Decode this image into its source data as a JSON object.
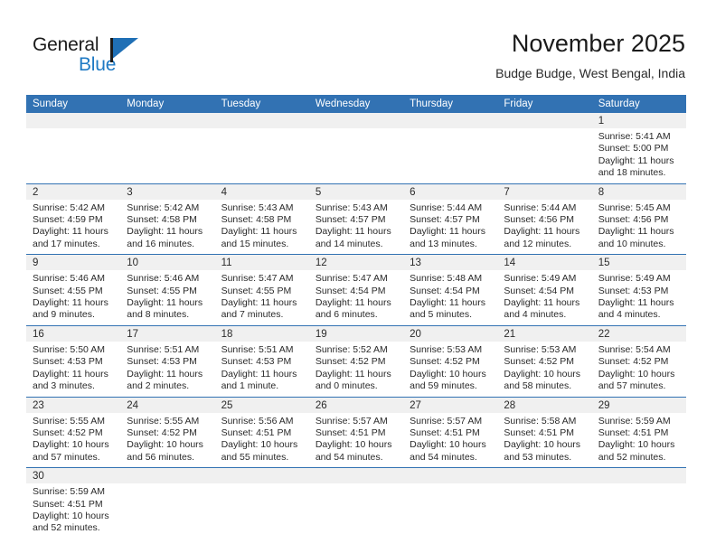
{
  "brand": {
    "line1": "General",
    "line2": "Blue",
    "flag_color": "#1f7ac4"
  },
  "header": {
    "title": "November 2025",
    "subtitle": "Budge Budge, West Bengal, India"
  },
  "theme": {
    "header_blue": "#3272b3",
    "date_band_gray": "#f0f0f0",
    "text": "#2a2a2a"
  },
  "weekdays": [
    "Sunday",
    "Monday",
    "Tuesday",
    "Wednesday",
    "Thursday",
    "Friday",
    "Saturday"
  ],
  "labels": {
    "sunrise": "Sunrise:",
    "sunset": "Sunset:",
    "daylight": "Daylight:"
  },
  "weeks": [
    [
      {
        "empty": true
      },
      {
        "empty": true
      },
      {
        "empty": true
      },
      {
        "empty": true
      },
      {
        "empty": true
      },
      {
        "empty": true
      },
      {
        "day": "1",
        "sunrise": "Sunrise: 5:41 AM",
        "sunset": "Sunset: 5:00 PM",
        "daylight": "Daylight: 11 hours and 18 minutes."
      }
    ],
    [
      {
        "day": "2",
        "sunrise": "Sunrise: 5:42 AM",
        "sunset": "Sunset: 4:59 PM",
        "daylight": "Daylight: 11 hours and 17 minutes."
      },
      {
        "day": "3",
        "sunrise": "Sunrise: 5:42 AM",
        "sunset": "Sunset: 4:58 PM",
        "daylight": "Daylight: 11 hours and 16 minutes."
      },
      {
        "day": "4",
        "sunrise": "Sunrise: 5:43 AM",
        "sunset": "Sunset: 4:58 PM",
        "daylight": "Daylight: 11 hours and 15 minutes."
      },
      {
        "day": "5",
        "sunrise": "Sunrise: 5:43 AM",
        "sunset": "Sunset: 4:57 PM",
        "daylight": "Daylight: 11 hours and 14 minutes."
      },
      {
        "day": "6",
        "sunrise": "Sunrise: 5:44 AM",
        "sunset": "Sunset: 4:57 PM",
        "daylight": "Daylight: 11 hours and 13 minutes."
      },
      {
        "day": "7",
        "sunrise": "Sunrise: 5:44 AM",
        "sunset": "Sunset: 4:56 PM",
        "daylight": "Daylight: 11 hours and 12 minutes."
      },
      {
        "day": "8",
        "sunrise": "Sunrise: 5:45 AM",
        "sunset": "Sunset: 4:56 PM",
        "daylight": "Daylight: 11 hours and 10 minutes."
      }
    ],
    [
      {
        "day": "9",
        "sunrise": "Sunrise: 5:46 AM",
        "sunset": "Sunset: 4:55 PM",
        "daylight": "Daylight: 11 hours and 9 minutes."
      },
      {
        "day": "10",
        "sunrise": "Sunrise: 5:46 AM",
        "sunset": "Sunset: 4:55 PM",
        "daylight": "Daylight: 11 hours and 8 minutes."
      },
      {
        "day": "11",
        "sunrise": "Sunrise: 5:47 AM",
        "sunset": "Sunset: 4:55 PM",
        "daylight": "Daylight: 11 hours and 7 minutes."
      },
      {
        "day": "12",
        "sunrise": "Sunrise: 5:47 AM",
        "sunset": "Sunset: 4:54 PM",
        "daylight": "Daylight: 11 hours and 6 minutes."
      },
      {
        "day": "13",
        "sunrise": "Sunrise: 5:48 AM",
        "sunset": "Sunset: 4:54 PM",
        "daylight": "Daylight: 11 hours and 5 minutes."
      },
      {
        "day": "14",
        "sunrise": "Sunrise: 5:49 AM",
        "sunset": "Sunset: 4:54 PM",
        "daylight": "Daylight: 11 hours and 4 minutes."
      },
      {
        "day": "15",
        "sunrise": "Sunrise: 5:49 AM",
        "sunset": "Sunset: 4:53 PM",
        "daylight": "Daylight: 11 hours and 4 minutes."
      }
    ],
    [
      {
        "day": "16",
        "sunrise": "Sunrise: 5:50 AM",
        "sunset": "Sunset: 4:53 PM",
        "daylight": "Daylight: 11 hours and 3 minutes."
      },
      {
        "day": "17",
        "sunrise": "Sunrise: 5:51 AM",
        "sunset": "Sunset: 4:53 PM",
        "daylight": "Daylight: 11 hours and 2 minutes."
      },
      {
        "day": "18",
        "sunrise": "Sunrise: 5:51 AM",
        "sunset": "Sunset: 4:53 PM",
        "daylight": "Daylight: 11 hours and 1 minute."
      },
      {
        "day": "19",
        "sunrise": "Sunrise: 5:52 AM",
        "sunset": "Sunset: 4:52 PM",
        "daylight": "Daylight: 11 hours and 0 minutes."
      },
      {
        "day": "20",
        "sunrise": "Sunrise: 5:53 AM",
        "sunset": "Sunset: 4:52 PM",
        "daylight": "Daylight: 10 hours and 59 minutes."
      },
      {
        "day": "21",
        "sunrise": "Sunrise: 5:53 AM",
        "sunset": "Sunset: 4:52 PM",
        "daylight": "Daylight: 10 hours and 58 minutes."
      },
      {
        "day": "22",
        "sunrise": "Sunrise: 5:54 AM",
        "sunset": "Sunset: 4:52 PM",
        "daylight": "Daylight: 10 hours and 57 minutes."
      }
    ],
    [
      {
        "day": "23",
        "sunrise": "Sunrise: 5:55 AM",
        "sunset": "Sunset: 4:52 PM",
        "daylight": "Daylight: 10 hours and 57 minutes."
      },
      {
        "day": "24",
        "sunrise": "Sunrise: 5:55 AM",
        "sunset": "Sunset: 4:52 PM",
        "daylight": "Daylight: 10 hours and 56 minutes."
      },
      {
        "day": "25",
        "sunrise": "Sunrise: 5:56 AM",
        "sunset": "Sunset: 4:51 PM",
        "daylight": "Daylight: 10 hours and 55 minutes."
      },
      {
        "day": "26",
        "sunrise": "Sunrise: 5:57 AM",
        "sunset": "Sunset: 4:51 PM",
        "daylight": "Daylight: 10 hours and 54 minutes."
      },
      {
        "day": "27",
        "sunrise": "Sunrise: 5:57 AM",
        "sunset": "Sunset: 4:51 PM",
        "daylight": "Daylight: 10 hours and 54 minutes."
      },
      {
        "day": "28",
        "sunrise": "Sunrise: 5:58 AM",
        "sunset": "Sunset: 4:51 PM",
        "daylight": "Daylight: 10 hours and 53 minutes."
      },
      {
        "day": "29",
        "sunrise": "Sunrise: 5:59 AM",
        "sunset": "Sunset: 4:51 PM",
        "daylight": "Daylight: 10 hours and 52 minutes."
      }
    ],
    [
      {
        "day": "30",
        "sunrise": "Sunrise: 5:59 AM",
        "sunset": "Sunset: 4:51 PM",
        "daylight": "Daylight: 10 hours and 52 minutes."
      },
      {
        "empty": true
      },
      {
        "empty": true
      },
      {
        "empty": true
      },
      {
        "empty": true
      },
      {
        "empty": true
      },
      {
        "empty": true
      }
    ]
  ]
}
